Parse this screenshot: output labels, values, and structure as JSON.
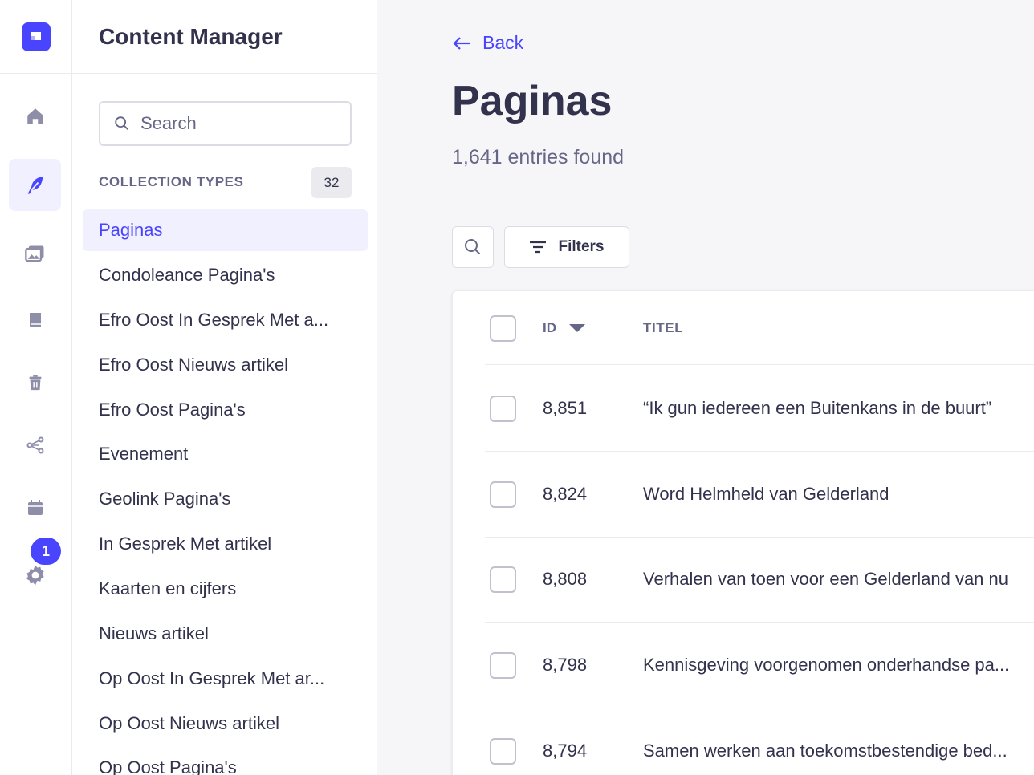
{
  "rail": {
    "badge_count": "1",
    "icons": [
      "logo-icon",
      "home-icon",
      "feather-icon",
      "media-library-icon",
      "book-icon",
      "trash-icon",
      "share-icon",
      "calendar-icon",
      "settings-icon"
    ],
    "accent": "#4945ff"
  },
  "subnav": {
    "title": "Content Manager",
    "search_placeholder": "Search",
    "section_label": "COLLECTION TYPES",
    "section_count": "32",
    "items": [
      {
        "label": "Paginas",
        "active": true
      },
      {
        "label": "Condoleance Pagina's"
      },
      {
        "label": "Efro Oost In Gesprek Met a..."
      },
      {
        "label": "Efro Oost Nieuws artikel"
      },
      {
        "label": "Efro Oost Pagina's"
      },
      {
        "label": "Evenement"
      },
      {
        "label": "Geolink Pagina's"
      },
      {
        "label": "In Gesprek Met artikel"
      },
      {
        "label": "Kaarten en cijfers"
      },
      {
        "label": "Nieuws artikel"
      },
      {
        "label": "Op Oost In Gesprek Met ar..."
      },
      {
        "label": "Op Oost Nieuws artikel"
      },
      {
        "label": "Op Oost Pagina's"
      }
    ]
  },
  "main": {
    "back_label": "Back",
    "page_title": "Paginas",
    "subtitle": "1,641 entries found",
    "filters_label": "Filters",
    "table": {
      "headers": {
        "id": "ID",
        "title": "TITEL"
      },
      "rows": [
        {
          "id": "8,851",
          "title": "“Ik gun iedereen een Buitenkans in de buurt”"
        },
        {
          "id": "8,824",
          "title": "Word Helmheld van Gelderland"
        },
        {
          "id": "8,808",
          "title": "Verhalen van toen voor een Gelderland van nu"
        },
        {
          "id": "8,798",
          "title": "Kennisgeving voorgenomen onderhandse pa..."
        },
        {
          "id": "8,794",
          "title": "Samen werken aan toekomstbestendige bed..."
        }
      ]
    }
  }
}
